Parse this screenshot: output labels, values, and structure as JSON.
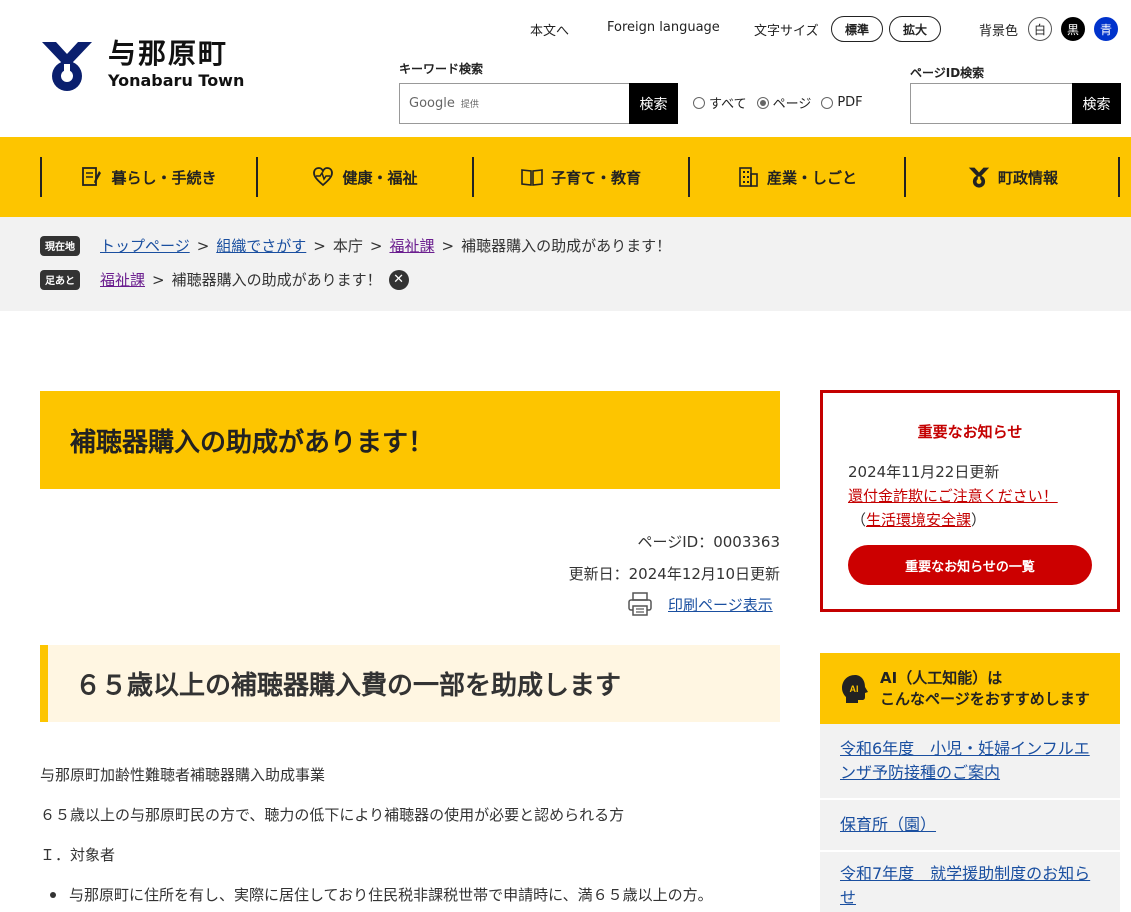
{
  "header": {
    "logo_ja": "与那原町",
    "logo_en": "Yonabaru Town",
    "links": {
      "skip": "本文へ",
      "foreign": "Foreign language",
      "text_size_label": "文字サイズ",
      "size_standard": "標準",
      "size_large": "拡大",
      "bg_label": "背景色",
      "bg_white": "白",
      "bg_black": "黒",
      "bg_blue": "青"
    },
    "search": {
      "keyword_label": "キーワード検索",
      "google_text": "Google",
      "google_provided": "提供",
      "button": "検索",
      "scope_all": "すべて",
      "scope_page": "ページ",
      "scope_pdf": "PDF",
      "selected_scope": "ページ",
      "page_id_label": "ページID検索",
      "page_id_button": "検索"
    }
  },
  "nav": {
    "items": [
      {
        "label": "暮らし・手続き",
        "icon": "document-pen-icon"
      },
      {
        "label": "健康・福祉",
        "icon": "heart-pulse-icon"
      },
      {
        "label": "子育て・教育",
        "icon": "open-book-icon"
      },
      {
        "label": "産業・しごと",
        "icon": "building-icon"
      },
      {
        "label": "町政情報",
        "icon": "town-emblem-icon"
      }
    ]
  },
  "breadcrumb": {
    "current_tag": "現在地",
    "items": [
      "トップページ",
      "組織でさがす",
      "本庁",
      "福祉課",
      "補聴器購入の助成があります！"
    ],
    "history_tag": "足あと",
    "history": [
      "福祉課",
      "補聴器購入の助成があります！"
    ]
  },
  "main": {
    "title": "補聴器購入の助成があります！",
    "page_id": "ページID：0003363",
    "updated": "更新日：2024年12月10日更新",
    "print_label": "印刷ページ表示",
    "heading2": "６５歳以上の補聴器購入費の一部を助成します",
    "para1": "与那原町加齢性難聴者補聴器購入助成事業",
    "para2": "６５歳以上の与那原町民の方で、聴力の低下により補聴器の使用が必要と認められる方",
    "section1": "Ｉ．対象者",
    "bullet1": "与那原町に住所を有し、実際に居住しており住民税非課税世帯で申請時に、満６５歳以上の方。"
  },
  "sidebar": {
    "notice": {
      "title": "重要なお知らせ",
      "date": "2024年11月22日更新",
      "link": "還付金詐欺にご注意ください！",
      "dept_open": "（",
      "dept": "生活環境安全課",
      "dept_close": "）",
      "button": "重要なお知らせの一覧"
    },
    "ai": {
      "icon_text": "AI",
      "title_line1": "AI（人工知能）は",
      "title_line2": "こんなページをおすすめします",
      "items": [
        "令和6年度　小児・妊婦インフルエンザ予防接種のご案内",
        "保育所（園）",
        "令和7年度　就学援助制度のお知らせ"
      ]
    }
  },
  "colors": {
    "brand_yellow": "#fdc500",
    "notice_red": "#c40000",
    "link_blue": "#1a4fa0",
    "visited_purple": "#6b1e8f",
    "bg_blue_button": "#0033cc"
  }
}
